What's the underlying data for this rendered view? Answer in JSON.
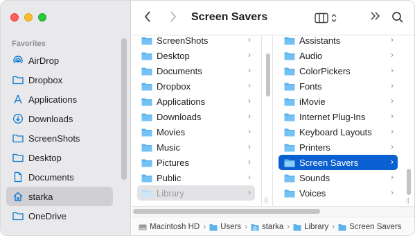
{
  "window": {
    "title": "Screen Savers"
  },
  "sidebar": {
    "section_title": "Favorites",
    "items": [
      {
        "label": "AirDrop",
        "icon": "airdrop-icon"
      },
      {
        "label": "Dropbox",
        "icon": "folder-icon"
      },
      {
        "label": "Applications",
        "icon": "applications-icon"
      },
      {
        "label": "Downloads",
        "icon": "downloads-icon"
      },
      {
        "label": "ScreenShots",
        "icon": "folder-icon"
      },
      {
        "label": "Desktop",
        "icon": "folder-icon"
      },
      {
        "label": "Documents",
        "icon": "document-icon"
      },
      {
        "label": "starka",
        "icon": "home-icon",
        "selected": true
      },
      {
        "label": "OneDrive",
        "icon": "folder-icon"
      }
    ]
  },
  "column1": {
    "items": [
      {
        "label": "ScreenShots"
      },
      {
        "label": "Desktop"
      },
      {
        "label": "Documents"
      },
      {
        "label": "Dropbox"
      },
      {
        "label": "Applications"
      },
      {
        "label": "Downloads"
      },
      {
        "label": "Movies"
      },
      {
        "label": "Music"
      },
      {
        "label": "Pictures"
      },
      {
        "label": "Public"
      },
      {
        "label": "Library",
        "state": "dimmed"
      }
    ]
  },
  "column2": {
    "items": [
      {
        "label": "Assistants"
      },
      {
        "label": "Audio"
      },
      {
        "label": "ColorPickers"
      },
      {
        "label": "Fonts"
      },
      {
        "label": "iMovie"
      },
      {
        "label": "Internet Plug-Ins"
      },
      {
        "label": "Keyboard Layouts"
      },
      {
        "label": "Printers"
      },
      {
        "label": "Screen Savers",
        "state": "selected"
      },
      {
        "label": "Sounds"
      },
      {
        "label": "Voices"
      }
    ]
  },
  "pathbar": {
    "crumbs": [
      "Macintosh HD",
      "Users",
      "starka",
      "Library",
      "Screen Savers"
    ]
  },
  "colors": {
    "folder": "#5eb3ef",
    "selection": "#0a5fd1",
    "sidebar_bg": "#e9e9eb",
    "sidebar_icon": "#0b79d0"
  }
}
